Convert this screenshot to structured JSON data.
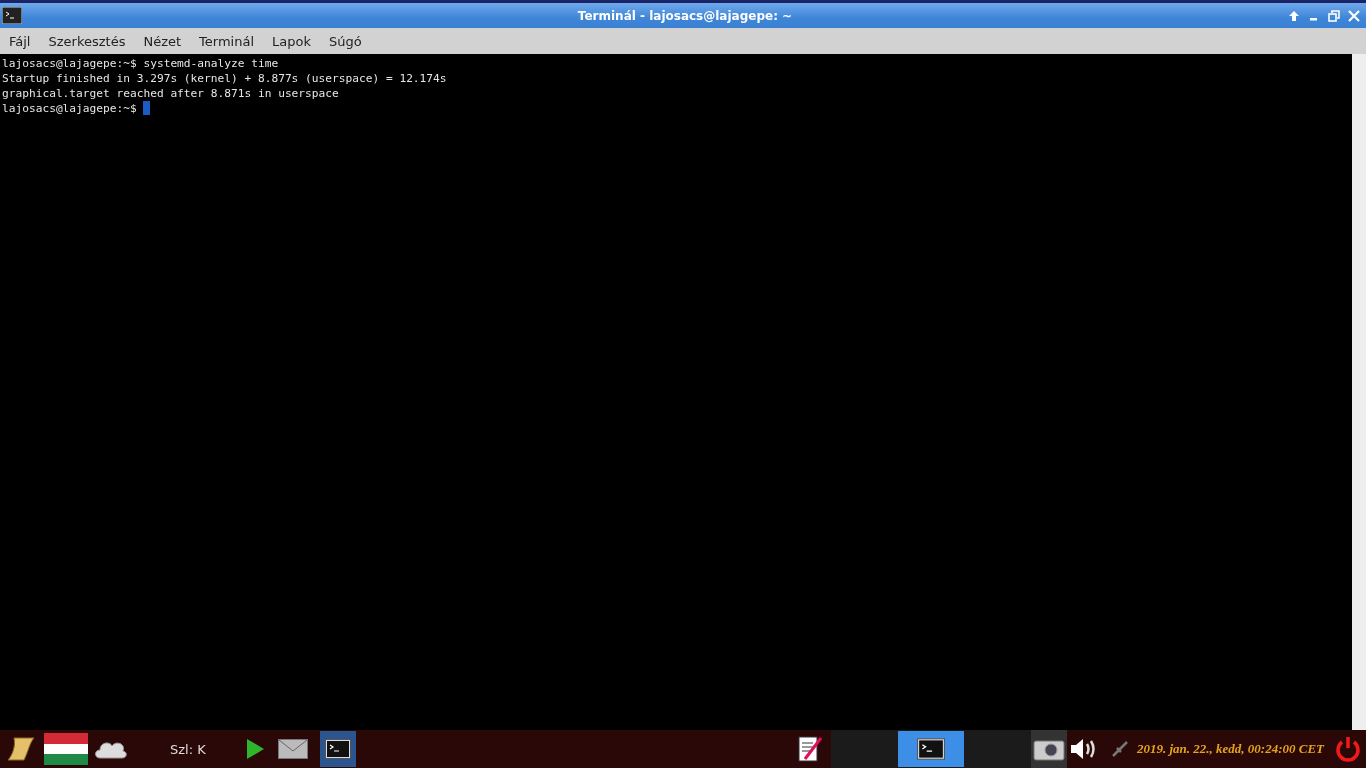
{
  "window": {
    "title": "Terminál - lajosacs@lajagepe: ~"
  },
  "menu": [
    "Fájl",
    "Szerkesztés",
    "Nézet",
    "Terminál",
    "Lapok",
    "Súgó"
  ],
  "terminal": {
    "lines": [
      "lajosacs@lajagepe:~$ systemd-analyze time",
      "Startup finished in 3.297s (kernel) + 8.877s (userspace) = 12.174s",
      "graphical.target reached after 8.871s in userspace"
    ],
    "prompt": "lajosacs@lajagepe:~$ "
  },
  "taskbar": {
    "keyboard": "Szl: K",
    "tasks": [
      {
        "selected": true
      }
    ],
    "clock": "2019. jan. 22., kedd, 00:24:00 CET"
  }
}
